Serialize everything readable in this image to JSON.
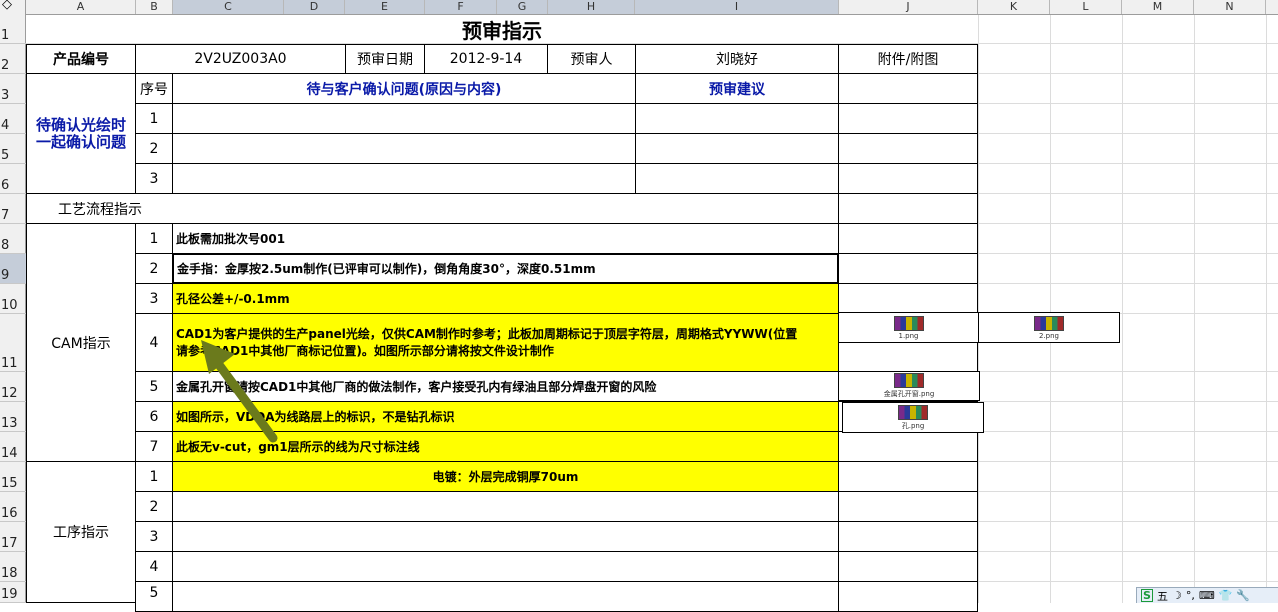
{
  "columns": [
    "A",
    "B",
    "C",
    "D",
    "E",
    "F",
    "G",
    "H",
    "I",
    "J",
    "K",
    "L",
    "M",
    "N"
  ],
  "rows": [
    "1",
    "2",
    "3",
    "4",
    "5",
    "6",
    "7",
    "8",
    "9",
    "10",
    "11",
    "12",
    "13",
    "14",
    "15",
    "16",
    "17",
    "18",
    "19"
  ],
  "title": "预审指示",
  "header": {
    "product_no_label": "产品编号",
    "product_no": "2V2UZ003A0",
    "review_date_label": "预审日期",
    "review_date": "2012-9-14",
    "reviewer_label": "预审人",
    "reviewer": "刘晓好",
    "attachment_label": "附件/附图"
  },
  "confirm_section": {
    "label": "待确认光绘时一起确认问题",
    "seq_header": "序号",
    "question_header": "待与客户确认问题(原因与内容)",
    "suggestion_header": "预审建议",
    "rows": [
      "1",
      "2",
      "3"
    ]
  },
  "process_flow_label": "工艺流程指示",
  "cam_section": {
    "label": "CAM指示",
    "items": [
      {
        "no": "1",
        "text": "此板需加批次号001"
      },
      {
        "no": "2",
        "text": "金手指：金厚按2.5um制作(已评审可以制作)，倒角角度30°，深度0.51mm"
      },
      {
        "no": "3",
        "text": "孔径公差+/-0.1mm"
      },
      {
        "no": "4",
        "text": "CAD1为客户提供的生产panel光绘，仅供CAM制作时参考；此板加周期标记于顶层字符层，周期格式YYWW(位置请参考CAD1中其他厂商标记位置)。如图所示部分请将按文件设计制作"
      },
      {
        "no": "5",
        "text": "金属孔开窗请按CAD1中其他厂商的做法制作，客户接受孔内有绿油且部分焊盘开窗的风险"
      },
      {
        "no": "6",
        "text": "如图所示，VDDA为线路层上的标识，不是钻孔标识"
      },
      {
        "no": "7",
        "text": "此板无v-cut，gm1层所示的线为尺寸标注线"
      }
    ],
    "attachments": [
      "1.png",
      "2.png",
      "金属孔开窗.png",
      "孔.png"
    ]
  },
  "process_section": {
    "label": "工序指示",
    "items": [
      {
        "no": "1",
        "text": "电镀：外层完成铜厚70um"
      },
      {
        "no": "2",
        "text": ""
      },
      {
        "no": "3",
        "text": ""
      },
      {
        "no": "4",
        "text": ""
      },
      {
        "no": "5",
        "text": ""
      }
    ]
  },
  "ime_bar": {
    "items": [
      "S",
      "五",
      "☽",
      "°,",
      "⌨",
      "👕",
      "🔧"
    ]
  },
  "colors": {
    "highlight": "#ffff00",
    "header_blue": "#0a1aa8",
    "arrow": "#6b7a1c"
  }
}
